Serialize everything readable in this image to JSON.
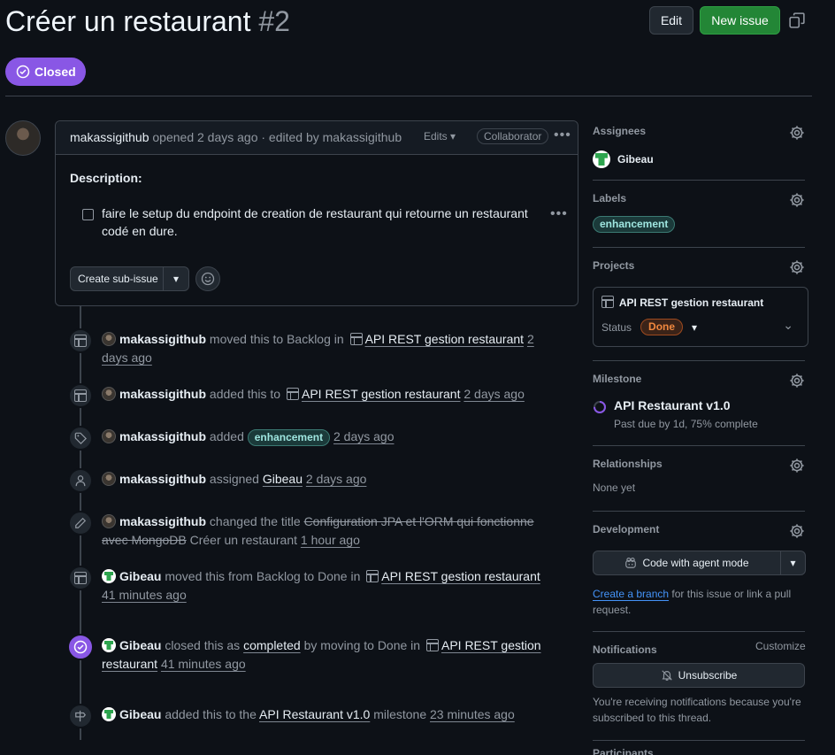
{
  "issue": {
    "title": "Créer un restaurant",
    "number": "#2",
    "state": "Closed",
    "edit_label": "Edit",
    "new_issue_label": "New issue"
  },
  "comment": {
    "author": "makassigithub",
    "meta": "opened 2 days ago · edited by makassigithub",
    "edits_label": "Edits",
    "role_badge": "Collaborator",
    "description_heading": "Description:",
    "task_text": "faire le setup du endpoint de creation de restaurant qui retourne un restaurant codé en dure.",
    "subissue_label": "Create sub-issue"
  },
  "timeline": {
    "e1": {
      "actor": "makassigithub",
      "text": "moved this to Backlog in",
      "project": "API REST gestion restaurant",
      "time": "2 days ago"
    },
    "e2": {
      "actor": "makassigithub",
      "text": "added this to",
      "project": "API REST gestion restaurant",
      "time": "2 days ago"
    },
    "e3": {
      "actor": "makassigithub",
      "text": "added",
      "label": "enhancement",
      "time": "2 days ago"
    },
    "e4": {
      "actor": "makassigithub",
      "text": "assigned",
      "assignee": "Gibeau",
      "time": "2 days ago"
    },
    "e5": {
      "actor": "makassigithub",
      "text": "changed the title",
      "old_title": "Configuration JPA et l'ORM qui fonctionne avec MongoDB",
      "new_title": "Créer un restaurant",
      "time": "1 hour ago"
    },
    "e6": {
      "actor": "Gibeau",
      "text": "moved this from Backlog to Done in",
      "project": "API REST gestion restaurant",
      "time": "41 minutes ago"
    },
    "e7": {
      "actor": "Gibeau",
      "text1": "closed this as",
      "completed": "completed",
      "text2": "by moving to Done in",
      "project": "API REST gestion restaurant",
      "time": "41 minutes ago"
    },
    "e8": {
      "actor": "Gibeau",
      "text1": "added this to the",
      "milestone": "API Restaurant v1.0",
      "text2": "milestone",
      "time": "23 minutes ago"
    }
  },
  "sidebar": {
    "assignees_heading": "Assignees",
    "assignee": "Gibeau",
    "labels_heading": "Labels",
    "label": "enhancement",
    "projects_heading": "Projects",
    "project_name": "API REST gestion restaurant",
    "status_label": "Status",
    "status_value": "Done",
    "milestone_heading": "Milestone",
    "milestone_name": "API Restaurant v1.0",
    "milestone_progress": "Past due by 1d, 75% complete",
    "milestone_fraction": 0.75,
    "relationships_heading": "Relationships",
    "relationships_value": "None yet",
    "development_heading": "Development",
    "agent_button": "Code with agent mode",
    "create_branch": "Create a branch",
    "branch_text": "for this issue or link a pull request.",
    "notifications_heading": "Notifications",
    "customize": "Customize",
    "unsubscribe": "Unsubscribe",
    "notif_reason": "You're receiving notifications because you're subscribed to this thread.",
    "participants_heading": "Participants"
  },
  "colors": {
    "closed": "#8957e5",
    "new_issue": "#238636",
    "link": "#4493f8",
    "done": "#f0883e"
  }
}
